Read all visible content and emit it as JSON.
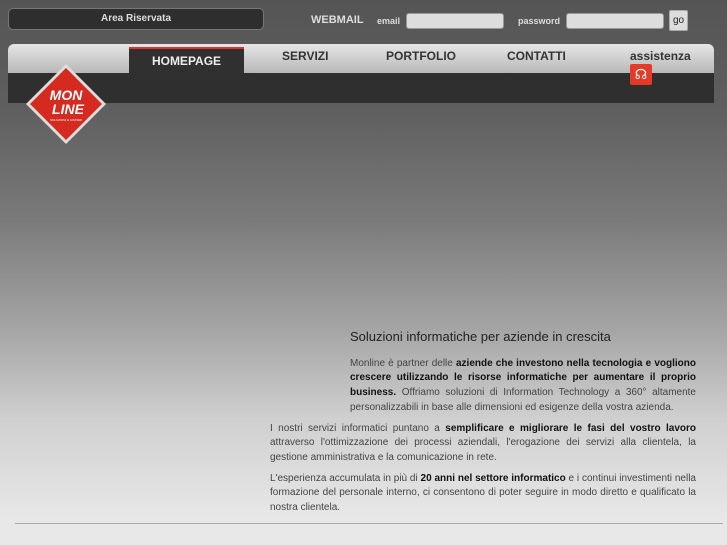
{
  "header": {
    "area_riservata": "Area Riservata",
    "webmail": "WEBMAIL",
    "email_label": "email",
    "email_value": "",
    "password_label": "password",
    "password_value": "",
    "go": "go"
  },
  "nav": {
    "items": [
      "HOMEPAGE",
      "SERVIZI",
      "PORTFOLIO",
      "CONTATTI",
      "assistenza"
    ],
    "active": "HOMEPAGE"
  },
  "logo": {
    "line1": "MON",
    "line2": "LINE",
    "tagline": "SOLUZIONI E SISTEMI INFORMATICI"
  },
  "main": {
    "title": "Soluzioni informatiche per aziende in crescita",
    "p1": {
      "a": "Monline è partner delle ",
      "b": "aziende che investono nella tecnologia e vogliono crescere utilizzando le risorse informatiche per aumentare il proprio business.",
      "c": " Offriamo soluzioni di Information Technology a 360° altamente personalizzabili in base alle dimensioni ed esigenze della vostra azienda."
    },
    "p2": {
      "a": "I nostri servizi informatici puntano a ",
      "b": "semplificare e migliorare le fasi del vostro lavoro",
      "c": " attraverso l'ottimizzazione dei processi aziendali, l'erogazione dei servizi alla clientela, la gestione amministrativa e la comunicazione in rete."
    },
    "p3": {
      "a": "L'esperienza accumulata in più di ",
      "b": "20 anni nel settore informatico",
      "c": " e i continui investimenti nella formazione del personale interno, ci consentono di poter seguire in modo diretto e qualificato la nostra clientela."
    }
  },
  "colors": {
    "accent": "#e53a28"
  }
}
